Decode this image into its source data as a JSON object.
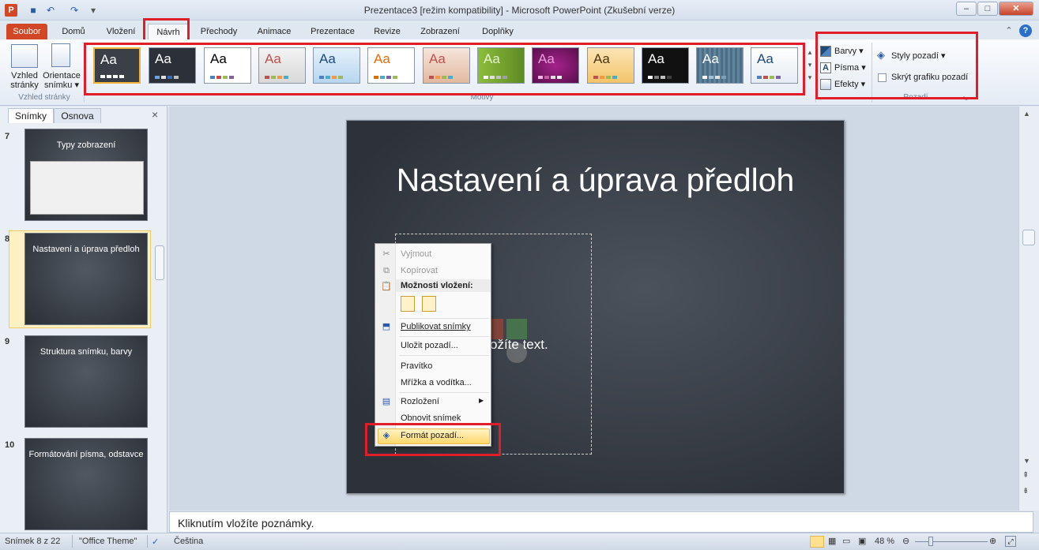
{
  "window": {
    "title": "Prezentace3 [režim kompatibility] - Microsoft PowerPoint (Zkušební verze)",
    "app_icon": "P"
  },
  "tabs": {
    "file": "Soubor",
    "items": [
      "Domů",
      "Vložení",
      "Návrh",
      "Přechody",
      "Animace",
      "Prezentace",
      "Revize",
      "Zobrazení",
      "Doplňky"
    ]
  },
  "ribbon": {
    "page_setup": {
      "btn1_line1": "Vzhled",
      "btn1_line2": "stránky",
      "btn2_line1": "Orientace",
      "btn2_line2": "snímku ▾",
      "group_label": "Vzhled stránky"
    },
    "themes": {
      "group_label": "Motivy",
      "sample": "Aa"
    },
    "theme_options": {
      "colors": "Barvy ▾",
      "fonts": "Písma ▾",
      "effects": "Efekty ▾"
    },
    "background": {
      "styles": "Styly pozadí ▾",
      "hide_graphics": "Skrýt grafiku pozadí",
      "group_label": "Pozadí"
    }
  },
  "left_pane": {
    "tab_slides": "Snímky",
    "tab_outline": "Osnova",
    "close": "×",
    "slides": [
      {
        "num": "7",
        "title": "Typy zobrazení"
      },
      {
        "num": "8",
        "title": "Nastavení a úprava předloh"
      },
      {
        "num": "9",
        "title": "Struktura snímku, barvy"
      },
      {
        "num": "10",
        "title": "Formátování písma, odstavce"
      }
    ]
  },
  "slide": {
    "title": "Nastavení a úprava předloh",
    "placeholder_text": "ožíte text."
  },
  "context_menu": {
    "cut": "Vyjmout",
    "copy": "Kopírovat",
    "paste_options": "Možnosti vložení:",
    "publish": "Publikovat snímky",
    "save_background": "Uložit pozadí...",
    "ruler": "Pravítko",
    "grid": "Mřížka a vodítka...",
    "layout": "Rozložení",
    "reset": "Obnovit snímek",
    "format_background": "Formát pozadí..."
  },
  "notes": {
    "placeholder": "Kliknutím vložíte poznámky."
  },
  "status": {
    "slide_counter": "Snímek 8 z 22",
    "theme": "\"Office Theme\"",
    "language": "Čeština",
    "zoom": "48 %"
  },
  "colors": {
    "accent": "#d24726",
    "highlight": "#e21d2a"
  }
}
